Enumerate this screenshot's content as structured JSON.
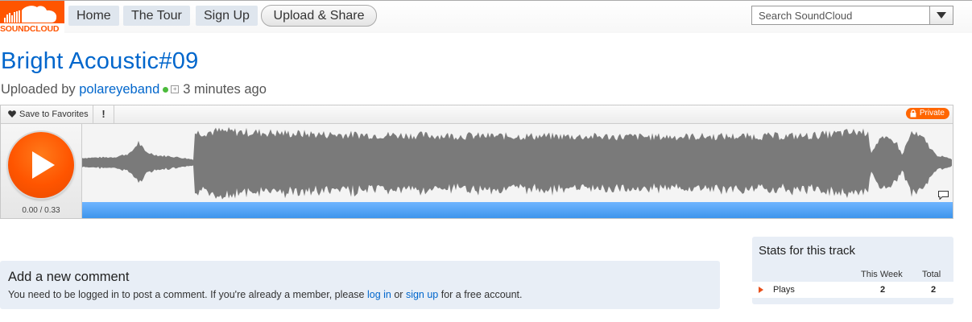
{
  "header": {
    "logo_text": "SOUNDCLOUD",
    "nav": [
      "Home",
      "The Tour",
      "Sign Up"
    ],
    "upload_label": "Upload & Share",
    "search_placeholder": "Search SoundCloud"
  },
  "track": {
    "title": "Bright Acoustic#09",
    "uploaded_prefix": "Uploaded by",
    "uploader": "polareyeband",
    "uploaded_ago": "3 minutes ago"
  },
  "player": {
    "favorite_label": "Save to Favorites",
    "report_label": "!",
    "private_label": "Private",
    "time_display": "0.00 / 0.33",
    "accent_color": "#ff5500",
    "progress_color": "#4a9ff5"
  },
  "comment": {
    "heading": "Add a new comment",
    "text_before": "You need to be logged in to post a comment. If you're already a member, please",
    "login_link": "log in",
    "text_middle": "or",
    "signup_link": "sign up",
    "text_after": "for a free account."
  },
  "stats": {
    "title": "Stats for this track",
    "columns": [
      "This Week",
      "Total"
    ],
    "rows": [
      {
        "label": "Plays",
        "week": "2",
        "total": "2"
      }
    ]
  }
}
